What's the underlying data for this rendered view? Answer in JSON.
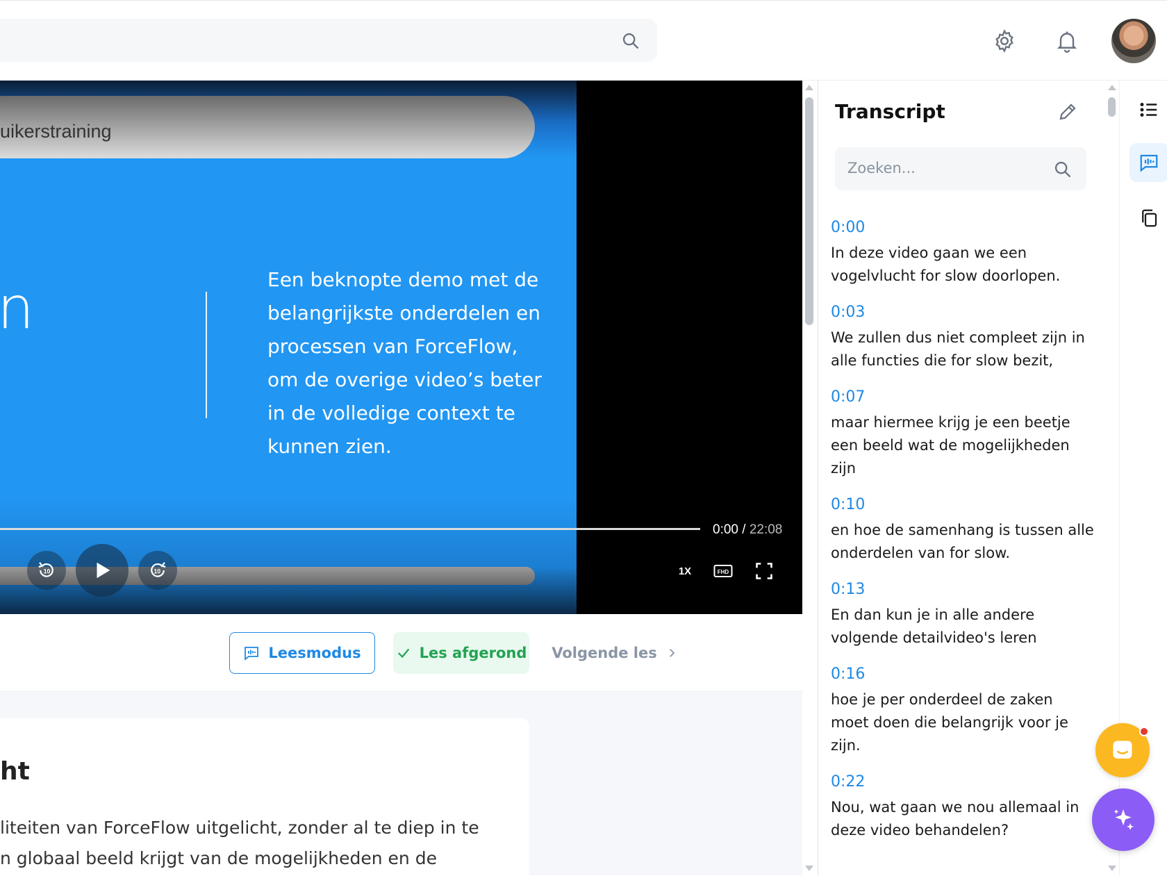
{
  "search": {
    "placeholder": ""
  },
  "video": {
    "slide_header": "uikerstraining",
    "slide_big_letter": "n",
    "slide_text": "Een beknopte demo met de\nbelangrijkste onderdelen en\nprocessen van ForceFlow,\nom de overige video’s beter\nin de volledige context te\nkunnen zien.",
    "current_time": "0:00",
    "separator": "/",
    "duration": "22:08",
    "progress": 0,
    "speed": "1X",
    "quality": "FHD"
  },
  "actions": {
    "read_mode": "Leesmodus",
    "completed": "Les afgerond",
    "next": "Volgende les"
  },
  "card": {
    "title": "ht",
    "body": "liteiten van ForceFlow uitgelicht, zonder al te diep in te\nn globaal beeld krijgt van de mogelijkheden en de"
  },
  "transcript": {
    "title": "Transcript",
    "search_placeholder": "Zoeken...",
    "entries": [
      {
        "time": "0:00",
        "text": "In deze video gaan we een vogelvlucht for slow doorlopen."
      },
      {
        "time": "0:03",
        "text": "We zullen dus niet compleet zijn in alle functies die for slow bezit,"
      },
      {
        "time": "0:07",
        "text": "maar hiermee krijg je een beetje een beeld wat de mogelijkheden zijn"
      },
      {
        "time": "0:10",
        "text": "en hoe de samenhang is tussen alle onderdelen van for slow."
      },
      {
        "time": "0:13",
        "text": "En dan kun je in alle andere volgende detailvideo's leren"
      },
      {
        "time": "0:16",
        "text": "hoe je per onderdeel de zaken moet doen die belangrijk voor je zijn."
      },
      {
        "time": "0:22",
        "text": "Nou, wat gaan we nou allemaal in deze video behandelen?"
      }
    ]
  },
  "colors": {
    "accent": "#1e88e5",
    "success": "#22a352",
    "slide_blue": "#2196f3",
    "chat_fab": "#fbb820",
    "ai_fab": "#8b5cf6"
  }
}
